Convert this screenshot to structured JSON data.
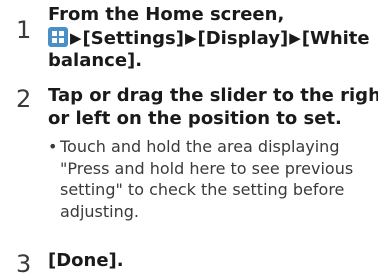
{
  "steps": [
    {
      "number": "1",
      "line1": "From the Home screen,",
      "line2_parts": [
        "[Settings]",
        "[Display]",
        "[White"
      ],
      "line3": "balance]."
    },
    {
      "number": "2",
      "line1": "Tap or drag the slider to the right",
      "line2": "or left on the position to set.",
      "note_bullet": "•",
      "note_lines": [
        "Touch and hold the area displaying",
        "\"Press and hold here to see previous",
        "setting\" to check the setting before",
        "adjusting."
      ]
    },
    {
      "number": "3",
      "line1": "[Done]."
    }
  ],
  "arrow_glyph": "▶",
  "icons": {
    "apps": "apps-grid-icon"
  },
  "colors": {
    "apps_icon": "#4a90c8",
    "text": "#1a1a1a",
    "step_number": "#3a3a3a"
  }
}
